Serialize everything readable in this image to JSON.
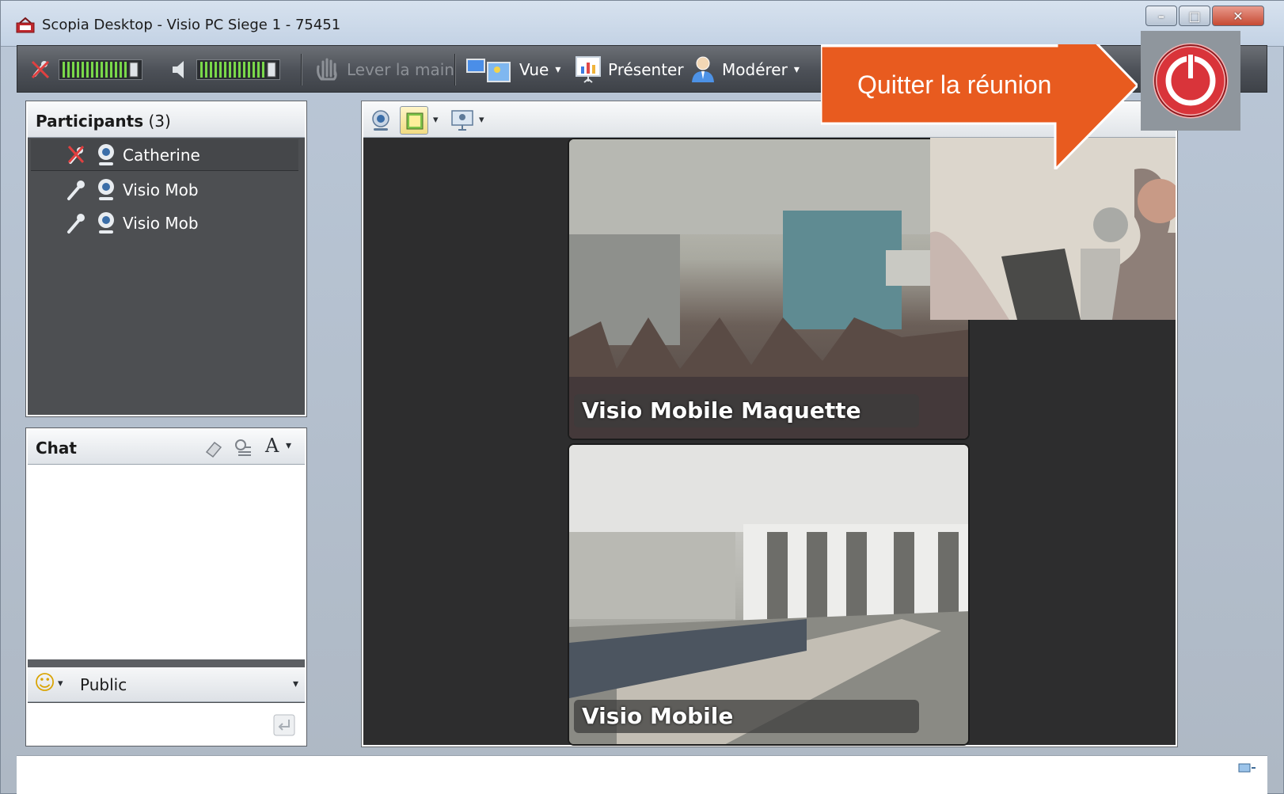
{
  "window": {
    "title": "Scopia Desktop - Visio PC Siege 1 - 75451",
    "controls": {
      "minimize": "–",
      "maximize": "□",
      "close": "✕"
    }
  },
  "toolbar": {
    "raise_hand": "Lever la main",
    "view": "Vue",
    "present": "Présenter",
    "moderate": "Modérer",
    "dropdown_glyph": "▾"
  },
  "participants": {
    "title": "Participants",
    "count": "(3)",
    "items": [
      {
        "name": "Catherine",
        "mic": "muted"
      },
      {
        "name": "Visio Mob",
        "mic": "on"
      },
      {
        "name": "Visio Mob",
        "mic": "on"
      }
    ]
  },
  "chat": {
    "title": "Chat",
    "recipient": "Public",
    "emoji_glyph": "☺",
    "dropdown_glyph": "▾",
    "format_glyph": "A"
  },
  "video": {
    "tiles": [
      {
        "label": "Visio Mobile Maquette"
      },
      {
        "label": "Visio Mobile"
      }
    ],
    "dropdown_glyph": "▾"
  },
  "callout": {
    "text": "Quitter la réunion",
    "color": "#e85b1f"
  },
  "colors": {
    "toolbar_bg": "#4c5057",
    "panel_bg": "#4d4f52",
    "level_green": "#7ad84a",
    "quit_red": "#d9343a"
  }
}
